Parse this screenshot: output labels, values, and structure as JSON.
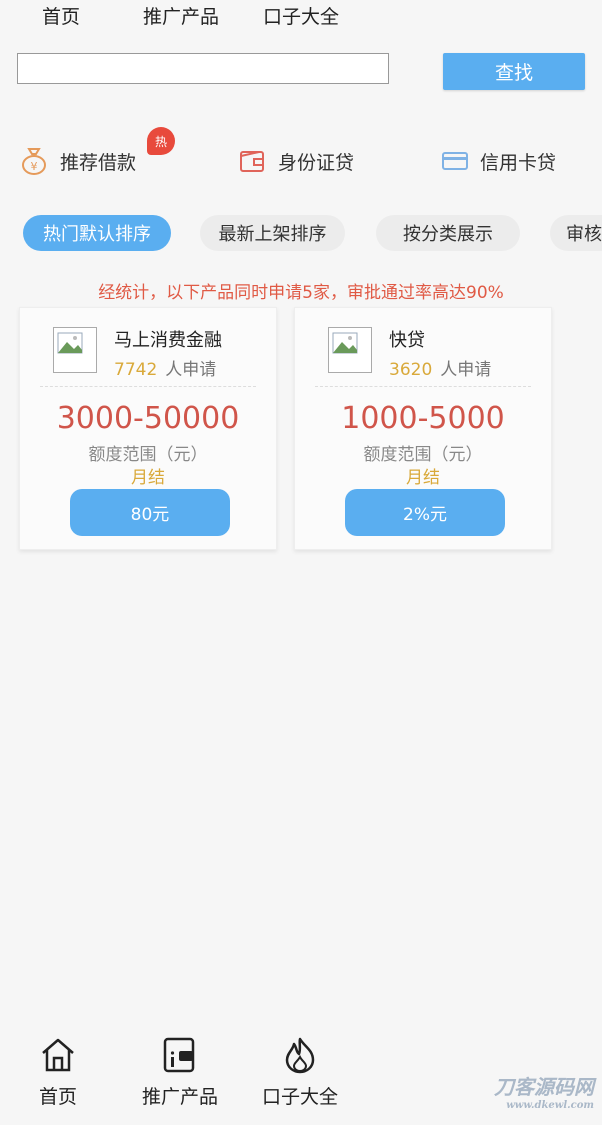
{
  "top_nav": [
    "首页",
    "推广产品",
    "口子大全"
  ],
  "search": {
    "value": "",
    "placeholder": "",
    "button_label": "查找"
  },
  "categories": [
    {
      "label": "推荐借款",
      "icon": "money-bag-icon",
      "badge": "热"
    },
    {
      "label": "身份证贷",
      "icon": "wallet-icon"
    },
    {
      "label": "信用卡贷",
      "icon": "credit-card-icon"
    }
  ],
  "sort_tabs": [
    "热门默认排序",
    "最新上架排序",
    "按分类展示",
    "审核"
  ],
  "active_sort_tab": 0,
  "notice": "经统计，以下产品同时申请5家，审批通过率高达90%",
  "products": [
    {
      "name": "马上消费金融",
      "applicants": "7742",
      "applicants_unit": "人申请",
      "range": "3000-50000",
      "range_label": "额度范围（元）",
      "settlement": "月结",
      "fee": "80元"
    },
    {
      "name": "快贷",
      "applicants": "3620",
      "applicants_unit": "人申请",
      "range": "1000-5000",
      "range_label": "额度范围（元）",
      "settlement": "月结",
      "fee": "2%元"
    }
  ],
  "bottom_nav": [
    {
      "label": "首页",
      "icon": "home-icon"
    },
    {
      "label": "推广产品",
      "icon": "wallet-card-icon"
    },
    {
      "label": "口子大全",
      "icon": "flame-icon"
    }
  ],
  "watermark": {
    "title": "刀客源码网",
    "url": "www.dkewl.com"
  },
  "colors": {
    "accent": "#5aaef0",
    "notice": "#e05a45",
    "range": "#d0554a",
    "highlight": "#d9a93a",
    "badge": "#e84a3c"
  }
}
